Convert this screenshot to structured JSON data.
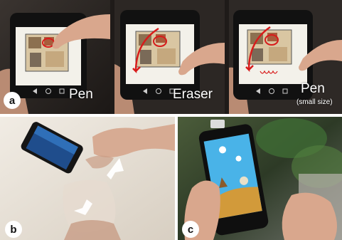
{
  "panel_a": {
    "label": "a",
    "captions": [
      "Pen",
      "Eraser",
      "Pen"
    ],
    "small_caption": "(small size)",
    "colors": {
      "ink": "#d81b1b",
      "bg": "#2b2522"
    }
  },
  "panel_b": {
    "label": "b",
    "colors": {
      "table": "#e9e2d7",
      "arrow": "#ffffff"
    }
  },
  "panel_c": {
    "label": "c",
    "colors": {
      "game_sky": "#3fa9e0",
      "background": "#3b4a2e"
    }
  }
}
